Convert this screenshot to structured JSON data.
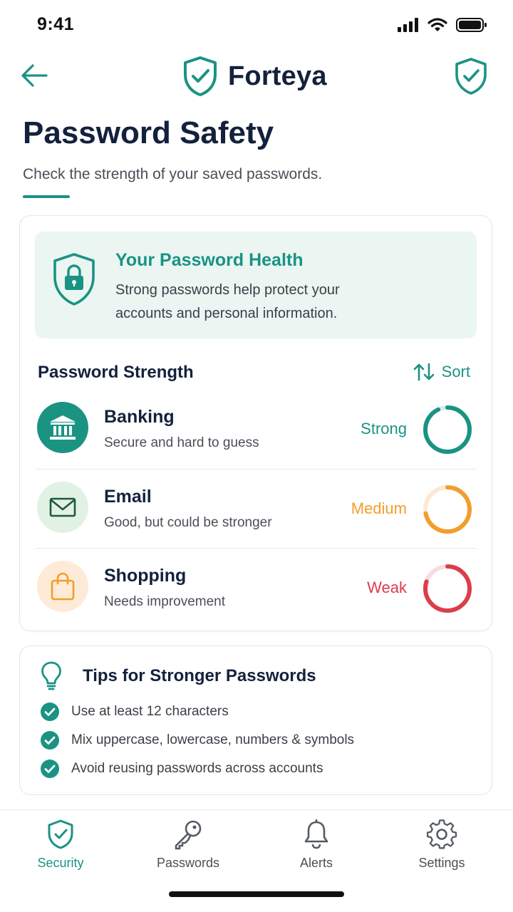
{
  "status": {
    "time": "9:41"
  },
  "header": {
    "brand": "Forteya"
  },
  "page": {
    "title": "Password Safety",
    "subtitle": "Check the strength of your saved passwords."
  },
  "health": {
    "title": "Your Password Health",
    "text": "Strong passwords help protect your accounts and personal information."
  },
  "strength": {
    "heading": "Password Strength",
    "sort_label": "Sort",
    "items": [
      {
        "name": "Banking",
        "description": "Secure and hard to guess",
        "level": "Strong",
        "icon": "bank-icon",
        "color": "#1a9383",
        "fill": 0.93
      },
      {
        "name": "Email",
        "description": "Good, but could be stronger",
        "level": "Medium",
        "icon": "mail-icon",
        "color": "#f29d2c",
        "fill": 0.72
      },
      {
        "name": "Shopping",
        "description": "Needs improvement",
        "level": "Weak",
        "icon": "shopping-bag-icon",
        "color": "#dc3d4b",
        "fill": 0.8
      }
    ]
  },
  "tips": {
    "title": "Tips for Stronger Passwords",
    "items": [
      "Use at least 12 characters",
      "Mix uppercase, lowercase, numbers & symbols",
      "Avoid reusing passwords across accounts"
    ]
  },
  "nav": [
    {
      "label": "Security",
      "icon": "shield-check-icon",
      "active": true
    },
    {
      "label": "Passwords",
      "icon": "key-icon",
      "active": false
    },
    {
      "label": "Alerts",
      "icon": "bell-icon",
      "active": false
    },
    {
      "label": "Settings",
      "icon": "gear-icon",
      "active": false
    }
  ],
  "colors": {
    "accent": "#1a9383",
    "medium": "#f29d2c",
    "weak": "#dc3d4b",
    "title": "#14213d"
  }
}
